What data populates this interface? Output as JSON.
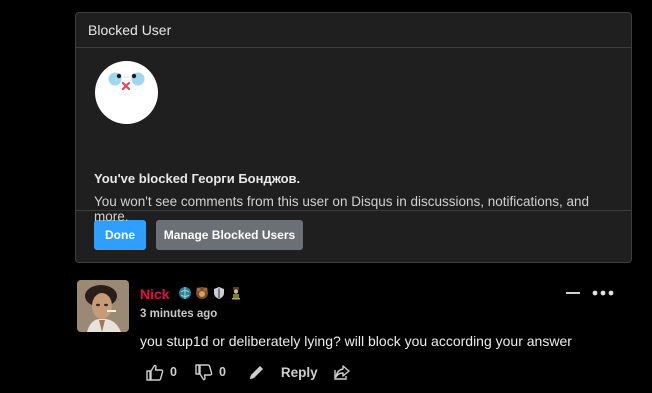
{
  "modal": {
    "title": "Blocked User",
    "heading": "You've blocked Георги Бонджов.",
    "description": "You won't see comments from this user on Disqus in discussions, notifications, and more.",
    "done_label": "Done",
    "manage_label": "Manage Blocked Users"
  },
  "comment": {
    "author": "Nick",
    "author_color": "#e7074d",
    "timestamp": "3 minutes ago",
    "text": "you stup1d or deliberately lying? will block you according your answer",
    "badges": [
      "globe-badge-icon",
      "bear-badge-icon",
      "shield-badge-icon",
      "person-badge-icon"
    ],
    "upvotes": "0",
    "downvotes": "0",
    "reply_label": "Reply"
  },
  "colors": {
    "accent": "#2e9fff",
    "background": "#000000",
    "card": "#1f1f1f"
  }
}
